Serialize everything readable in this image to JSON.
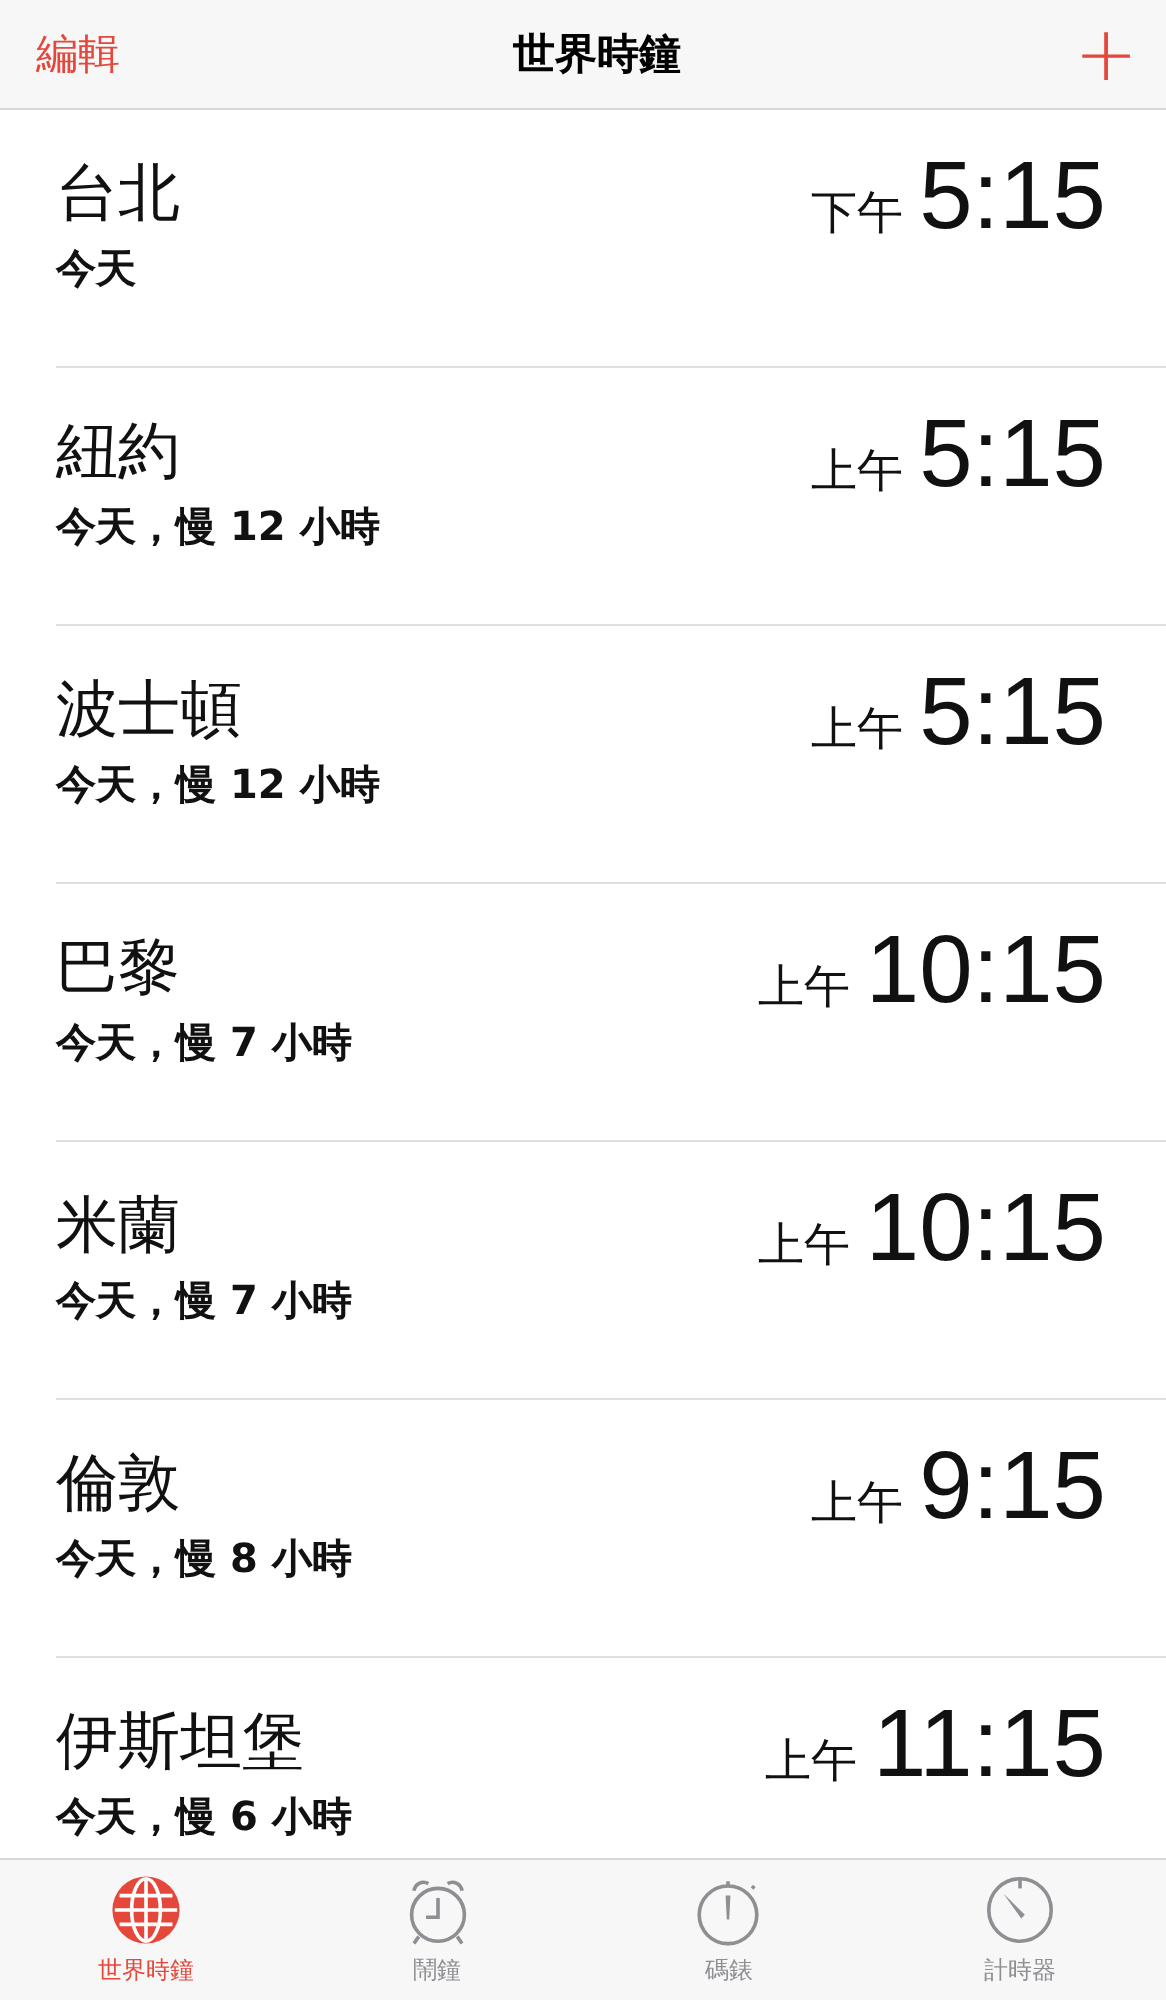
{
  "nav_bar": {
    "edit": "編輯",
    "title": "世界時鐘",
    "add": "+"
  },
  "clocks": [
    {
      "city": "台北",
      "offset": "今天",
      "period": "下午",
      "time": "5:15"
    },
    {
      "city": "紐約",
      "offset": "今天，慢 12 小時",
      "period": "上午",
      "time": "5:15"
    },
    {
      "city": "波士頓",
      "offset": "今天，慢 12 小時",
      "period": "上午",
      "time": "5:15"
    },
    {
      "city": "巴黎",
      "offset": "今天，慢 7 小時",
      "period": "上午",
      "time": "10:15"
    },
    {
      "city": "米蘭",
      "offset": "今天，慢 7 小時",
      "period": "上午",
      "time": "10:15"
    },
    {
      "city": "倫敦",
      "offset": "今天，慢 8 小時",
      "period": "上午",
      "time": "9:15"
    },
    {
      "city": "伊斯坦堡",
      "offset": "今天，慢 6 小時",
      "period": "上午",
      "time": "11:15"
    }
  ],
  "tab_bar": [
    {
      "kind": "globe",
      "label": "世界時鐘",
      "selected": true
    },
    {
      "kind": "alarm",
      "label": "鬧鐘",
      "selected": false
    },
    {
      "kind": "stopwatch",
      "label": "碼錶",
      "selected": false
    },
    {
      "kind": "timer",
      "label": "計時器",
      "selected": false
    }
  ]
}
